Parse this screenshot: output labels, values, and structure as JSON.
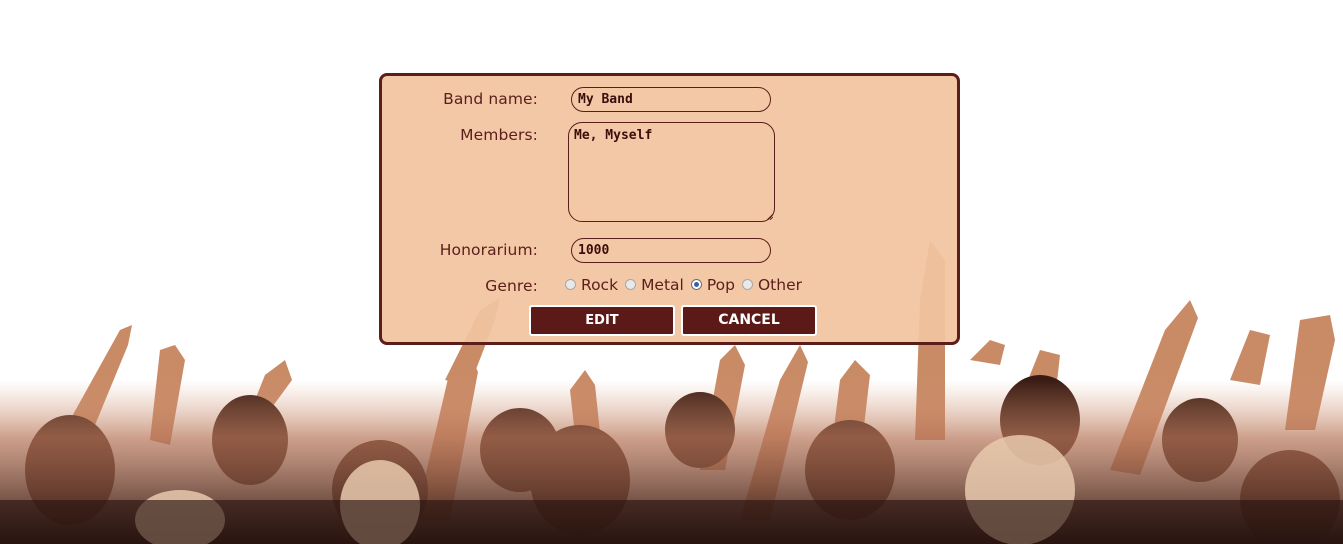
{
  "form": {
    "band_name": {
      "label": "Band name:",
      "value": "My Band"
    },
    "members": {
      "label": "Members:",
      "value": "Me, Myself"
    },
    "honorarium": {
      "label": "Honorarium:",
      "value": "1000"
    },
    "genre": {
      "label": "Genre:",
      "options": [
        "Rock",
        "Metal",
        "Pop",
        "Other"
      ],
      "selected": "Pop"
    },
    "buttons": {
      "edit": "EDIT",
      "cancel": "CANCEL"
    }
  },
  "colors": {
    "panel_background": "#f2c4a0",
    "panel_border": "#5b1e1a",
    "button_background": "#5b1a17",
    "text": "#5b1e1a"
  }
}
